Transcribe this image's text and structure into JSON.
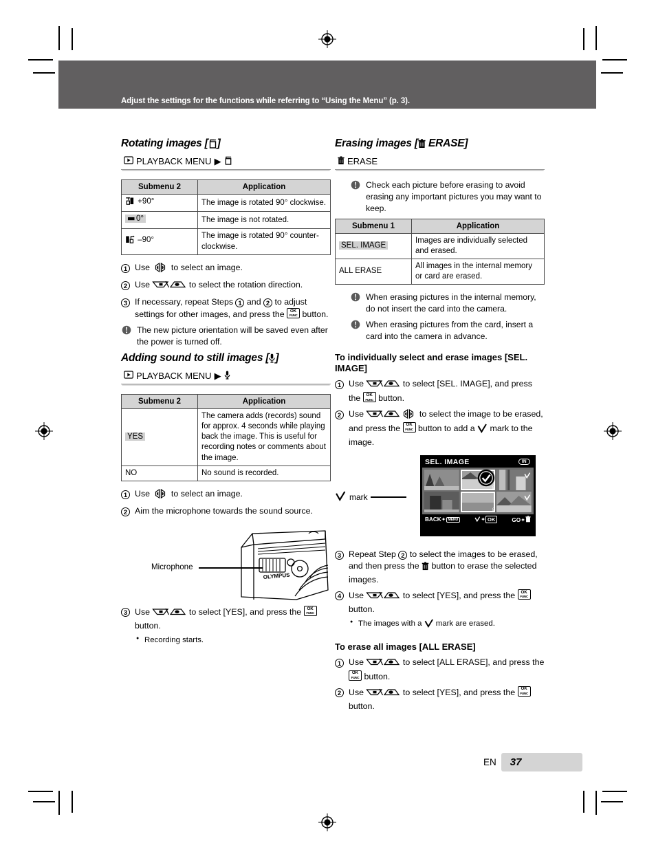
{
  "banner": {
    "text": "Adjust the settings for the functions while referring to “Using the Menu” (p. 3)."
  },
  "left": {
    "section1": {
      "heading": "Rotating images [↻]",
      "menu_path": "PLAYBACK MENU",
      "table": {
        "headers": [
          "Submenu 2",
          "Application"
        ],
        "rows": [
          {
            "submenu": "+90°",
            "application": "The image is rotated 90° clockwise."
          },
          {
            "submenu": "0°",
            "application": "The image is not rotated.",
            "highlight": true
          },
          {
            "submenu": "–90°",
            "application": "The image is rotated 90° counter-clockwise."
          }
        ]
      },
      "steps": [
        {
          "num": "1",
          "text_a": "Use ",
          "text_b": " to select an image."
        },
        {
          "num": "2",
          "text_a": "Use ",
          "text_b": " to select the rotation direction."
        },
        {
          "num": "3",
          "text_a": "If necessary, repeat Steps ",
          "text_b": " to adjust settings for other images, and press the ",
          "text_c": " button."
        }
      ],
      "note": "The new picture orientation will be saved even after the power is turned off."
    },
    "section2": {
      "heading": "Adding sound to still images [ ]",
      "menu_path": "PLAYBACK MENU",
      "table": {
        "headers": [
          "Submenu 2",
          "Application"
        ],
        "rows": [
          {
            "submenu": "YES",
            "application": "The camera adds (records) sound for approx. 4 seconds while playing back the image. This is useful for recording notes or comments about the image.",
            "highlight": true
          },
          {
            "submenu": "NO",
            "application": "No sound is recorded."
          }
        ]
      },
      "steps": [
        {
          "num": "1",
          "text_a": "Use ",
          "text_b": " to select an image."
        },
        {
          "num": "2",
          "text_a": "Aim the microphone towards the sound source."
        },
        {
          "num": "3",
          "text_a": "Use ",
          "text_b": " to select [YES], and press the ",
          "text_c": " button."
        }
      ],
      "illustration_label": "Microphone",
      "bullet": "Recording starts."
    }
  },
  "right": {
    "section1": {
      "heading": "Erasing images [ ERASE]",
      "menu_path": "ERASE",
      "note_top": "Check each picture before erasing to avoid erasing any important pictures you may want to keep.",
      "table": {
        "headers": [
          "Submenu 1",
          "Application"
        ],
        "rows": [
          {
            "submenu": "SEL. IMAGE",
            "application": "Images are individually selected and erased.",
            "highlight": true
          },
          {
            "submenu": "ALL ERASE",
            "application": "All images in the internal memory or card are erased."
          }
        ]
      },
      "notes": [
        "When erasing pictures in the internal memory, do not insert the card into the camera.",
        "When erasing pictures from the card, insert a card into the camera in advance."
      ]
    },
    "section2": {
      "heading": "To individually select and erase images [SEL. IMAGE]",
      "steps": [
        {
          "num": "1",
          "text_a": "Use ",
          "text_b": " to select [SEL. IMAGE], and press the ",
          "text_c": " button."
        },
        {
          "num": "2",
          "text_a": "Use ",
          "text_b": " to select the image to be erased, and press the ",
          "text_c": " button to add a ",
          "text_d": " mark to the image."
        },
        {
          "num": "3",
          "text_a": "Repeat Step ",
          "text_b": " to select the images to be erased, and then press the ",
          "text_c": " button to erase the selected images."
        },
        {
          "num": "4",
          "text_a": "Use ",
          "text_b": " to select [YES], and press the ",
          "text_c": " button."
        }
      ],
      "bullet_a": "The images with a ",
      "bullet_b": " mark are erased.",
      "lcd": {
        "title": "SEL. IMAGE",
        "memory_badge": "IN",
        "bar_back": "BACK",
        "bar_back_key": "MENU",
        "bar_ok_key": "OK",
        "bar_go": "GO",
        "mark_callout": "mark"
      }
    },
    "section3": {
      "heading": "To erase all images [ALL ERASE]",
      "steps": [
        {
          "num": "1",
          "text_a": "Use ",
          "text_b": " to select [ALL ERASE], and press the ",
          "text_c": " button."
        },
        {
          "num": "2",
          "text_a": "Use ",
          "text_b": " to select [YES], and press the ",
          "text_c": " button."
        }
      ]
    }
  },
  "footer": {
    "language": "EN",
    "page": "37"
  },
  "colors": {
    "banner": "#615f60",
    "table_header": "#d4d4d4",
    "highlight": "#d0d0d0"
  }
}
